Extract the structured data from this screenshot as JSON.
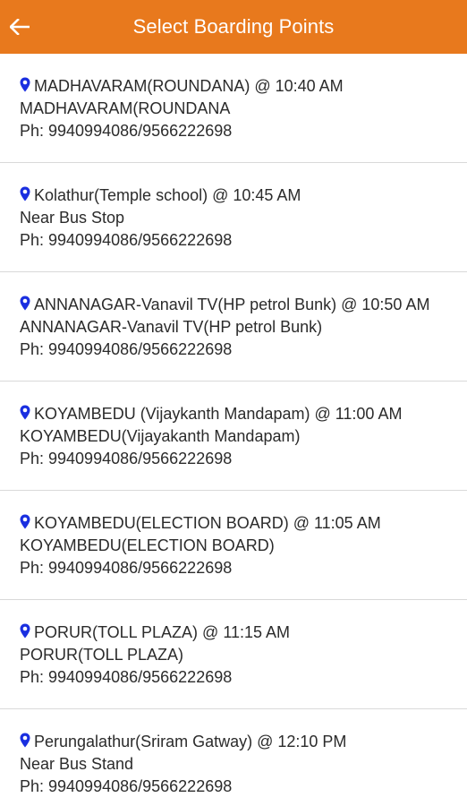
{
  "header": {
    "title": "Select Boarding Points",
    "back_icon": "arrow-left-icon"
  },
  "colors": {
    "header_bg": "#e8791d",
    "pin": "#1a2fe0"
  },
  "boarding_points": [
    {
      "title": "MADHAVARAM(ROUNDANA) @ 10:40 AM",
      "address": "MADHAVARAM(ROUNDANA",
      "phone": "Ph: 9940994086/9566222698"
    },
    {
      "title": "Kolathur(Temple school) @ 10:45 AM",
      "address": "Near Bus Stop",
      "phone": "Ph: 9940994086/9566222698"
    },
    {
      "title": "ANNANAGAR-Vanavil TV(HP petrol Bunk) @ 10:50 AM",
      "address": "ANNANAGAR-Vanavil TV(HP petrol Bunk)",
      "phone": "Ph: 9940994086/9566222698"
    },
    {
      "title": "KOYAMBEDU (Vijaykanth Mandapam) @ 11:00 AM",
      "address": "KOYAMBEDU(Vijayakanth Mandapam)",
      "phone": "Ph: 9940994086/9566222698"
    },
    {
      "title": "KOYAMBEDU(ELECTION BOARD) @ 11:05 AM",
      "address": "KOYAMBEDU(ELECTION BOARD)",
      "phone": "Ph: 9940994086/9566222698"
    },
    {
      "title": "PORUR(TOLL PLAZA) @ 11:15 AM",
      "address": "PORUR(TOLL PLAZA)",
      "phone": "Ph: 9940994086/9566222698"
    },
    {
      "title": "Perungalathur(Sriram Gatway) @ 12:10 PM",
      "address": "Near Bus Stand",
      "phone": "Ph: 9940994086/9566222698"
    }
  ]
}
